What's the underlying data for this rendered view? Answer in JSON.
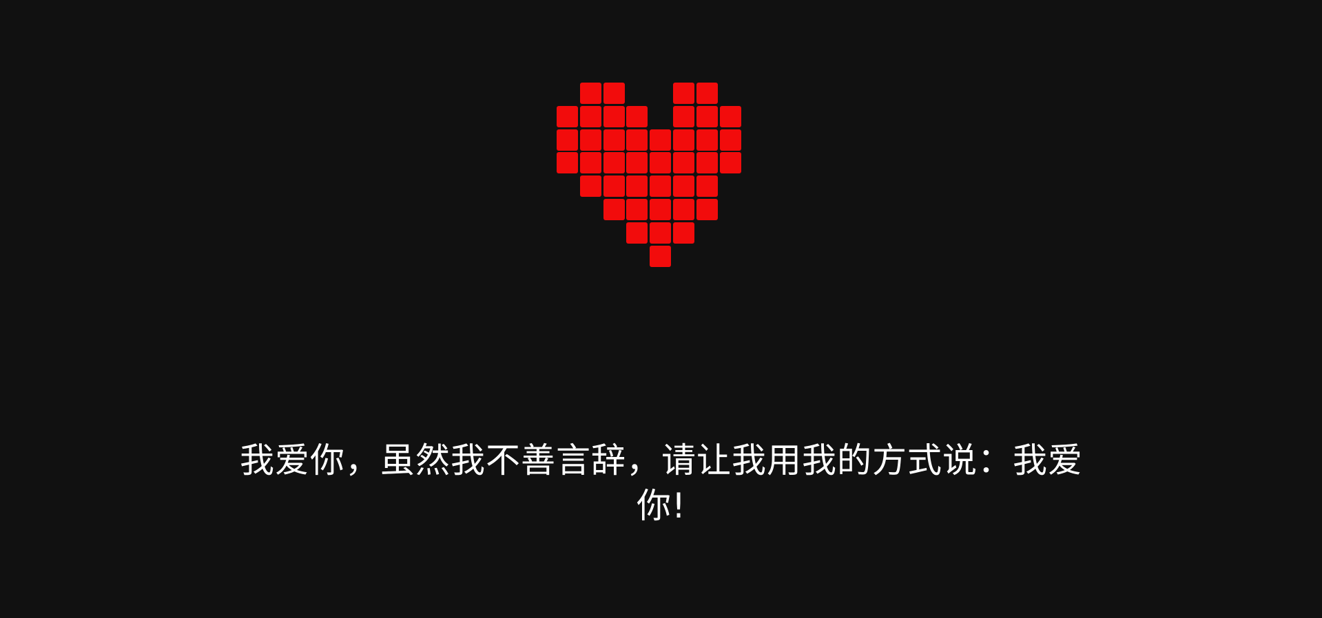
{
  "heart": {
    "color": "#f20c0c",
    "pattern": [
      "01100110",
      "11110111",
      "11111111",
      "11111111",
      "01111110",
      "00111110",
      "00011100",
      "00001000"
    ]
  },
  "message": "我爱你，虽然我不善言辞，请让我用我的方式说：我爱你!"
}
